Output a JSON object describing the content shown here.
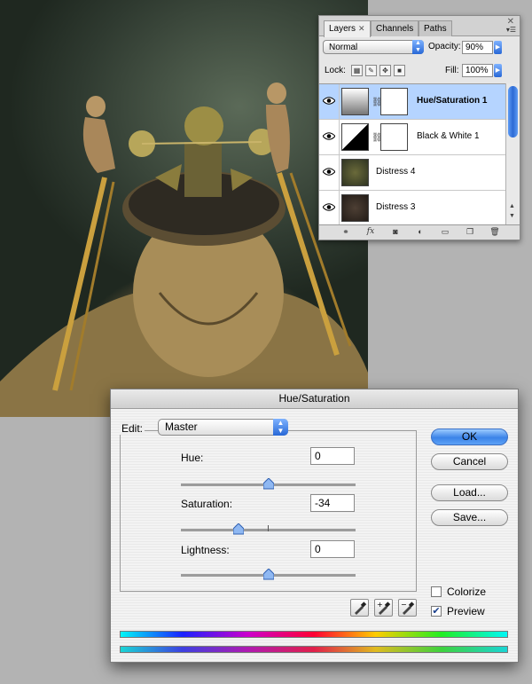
{
  "layers_palette": {
    "tabs": [
      {
        "label": "Layers",
        "active": true
      },
      {
        "label": "Channels",
        "active": false
      },
      {
        "label": "Paths",
        "active": false
      }
    ],
    "blend_mode": "Normal",
    "opacity_label": "Opacity:",
    "opacity_value": "90%",
    "lock_label": "Lock:",
    "fill_label": "Fill:",
    "fill_value": "100%",
    "layers": [
      {
        "name": "Hue/Saturation 1",
        "selected": true
      },
      {
        "name": "Black & White 1",
        "selected": false
      },
      {
        "name": "Distress 4",
        "selected": false
      },
      {
        "name": "Distress 3",
        "selected": false
      }
    ],
    "footer_icons": [
      "link-icon",
      "fx-icon",
      "mask-icon",
      "adjustment-icon",
      "group-folder-icon",
      "new-layer-icon",
      "trash-icon"
    ],
    "fx_label": "fx"
  },
  "hue_saturation_dialog": {
    "title": "Hue/Saturation",
    "edit_label": "Edit:",
    "edit_value": "Master",
    "hue_label": "Hue:",
    "hue_value": "0",
    "hue": 0,
    "saturation_label": "Saturation:",
    "saturation_value": "-34",
    "saturation": -34,
    "lightness_label": "Lightness:",
    "lightness_value": "0",
    "lightness": 0,
    "buttons": {
      "ok": "OK",
      "cancel": "Cancel",
      "load": "Load...",
      "save": "Save..."
    },
    "colorize_label": "Colorize",
    "colorize_checked": false,
    "preview_label": "Preview",
    "preview_checked": true
  },
  "colors": {
    "selection": "#b5d4ff",
    "aqua_blue": "#3b83e8",
    "desktop": "#b3b3b3"
  }
}
